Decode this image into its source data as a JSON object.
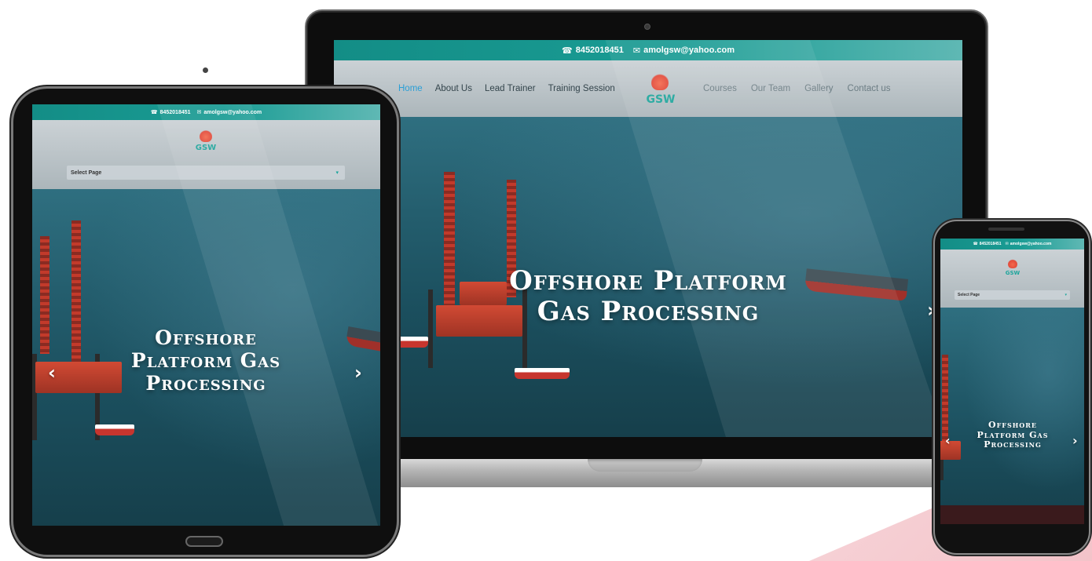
{
  "site": {
    "phone": "8452018451",
    "email": "amolgsw@yahoo.com",
    "logo_text": "GSW",
    "select_label": "Select Page",
    "hero_title": "Offshore Platform Gas Processing",
    "hero_title_laptop_line1": "Offshore Platform",
    "hero_title_laptop_line2": "Gas Processing",
    "hero_title_tablet_line1": "Offshore",
    "hero_title_tablet_line2": "Platform Gas",
    "hero_title_tablet_line3": "Processing",
    "prev_arrow": "‹",
    "next_arrow": "›",
    "nav": [
      "Home",
      "About Us",
      "Lead Trainer",
      "Training Session",
      "Courses",
      "Our Team",
      "Gallery",
      "Contact us"
    ]
  },
  "colors": {
    "teal": "#1a9c94",
    "accent_pink": "#f3c3c9",
    "nav_active": "#2a9fd6"
  },
  "icons": {
    "phone": "phone-icon",
    "email": "envelope-icon",
    "menu_caret": "chevron-down-icon"
  }
}
